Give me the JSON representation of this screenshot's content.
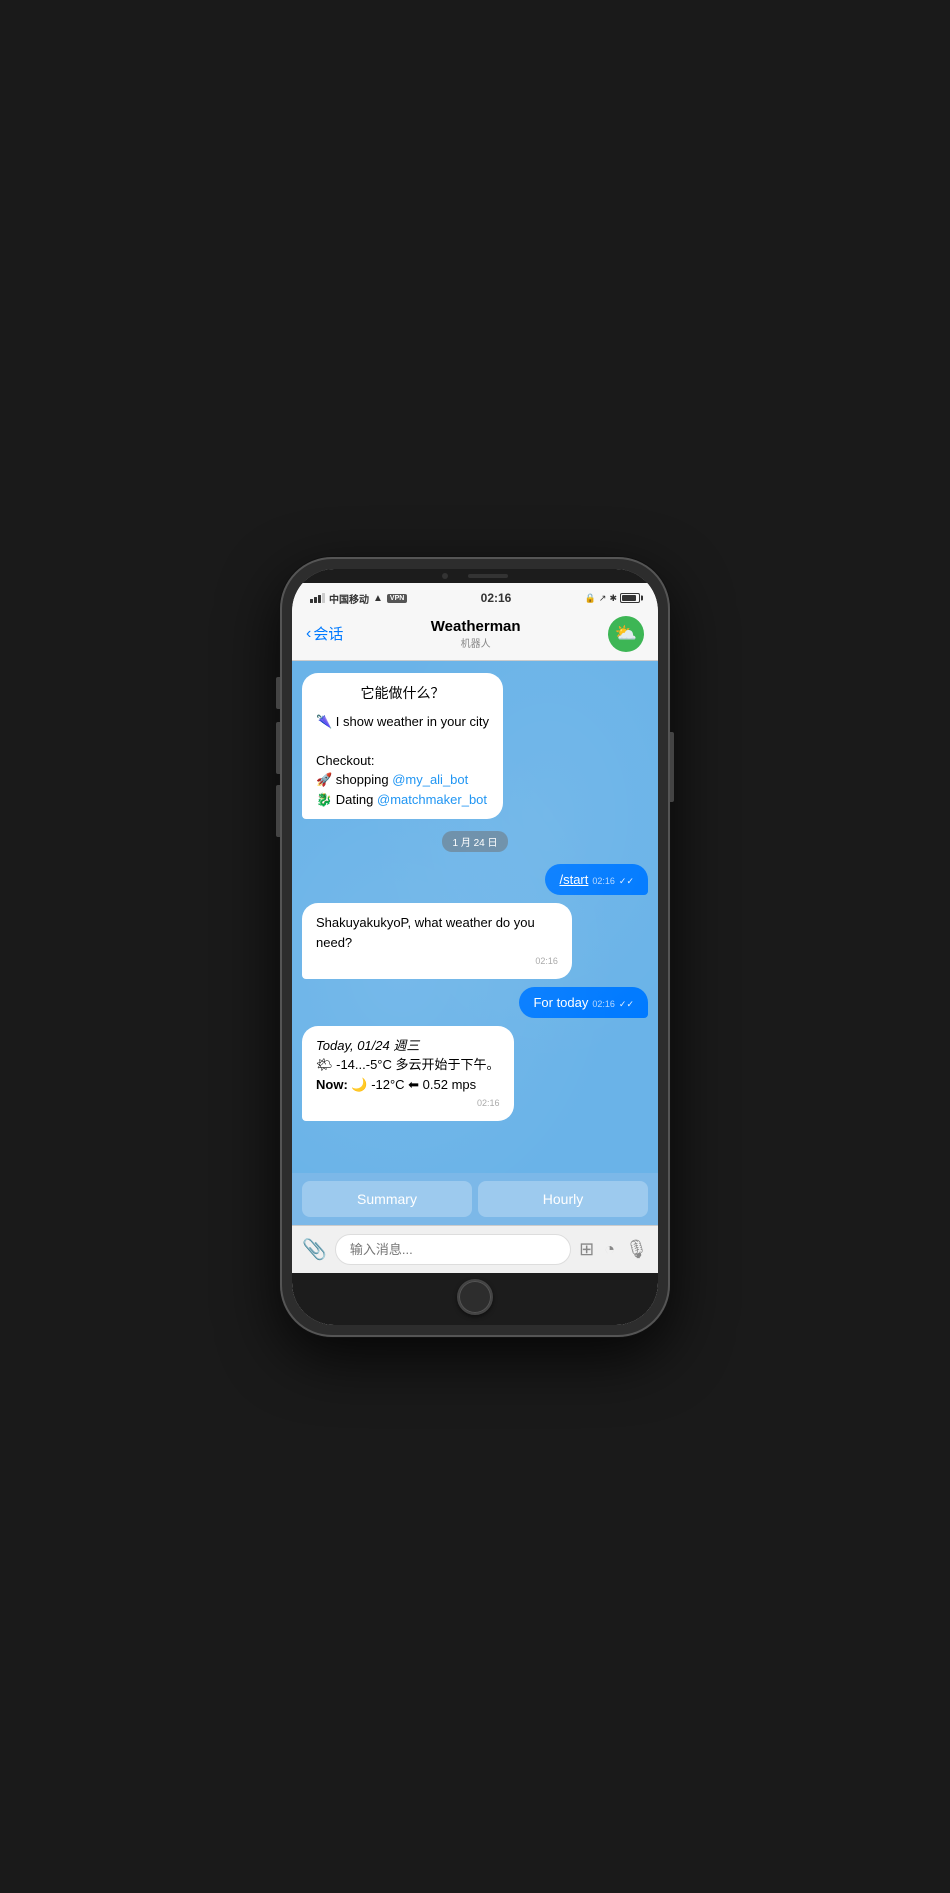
{
  "status": {
    "carrier": "中国移动",
    "time": "02:16",
    "signal_label": "signal",
    "wifi_label": "wifi",
    "vpn_label": "VPN"
  },
  "nav": {
    "back_label": "会话",
    "title": "Weatherman",
    "subtitle": "机器人"
  },
  "messages": [
    {
      "type": "incoming",
      "header": "它能做什么？",
      "lines": [
        "🌂 I show weather in your city",
        "",
        "Checkout:",
        "🚀 shopping @my_ali_bot",
        "🐉 Dating @matchmaker_bot"
      ]
    },
    {
      "type": "date",
      "text": "1 月 24 日"
    },
    {
      "type": "outgoing",
      "text": "/start",
      "time": "02:16",
      "checks": "✓✓"
    },
    {
      "type": "incoming",
      "text": "ShakuyakukyoP, what weather do you need?",
      "time": "02:16"
    },
    {
      "type": "outgoing",
      "text": "For today",
      "time": "02:16",
      "checks": "✓✓"
    },
    {
      "type": "incoming_weather",
      "line1": "Today, 01/24 週三",
      "line2": "🌤 -14...-5°C 多云开始于下午。",
      "line3": "Now: 🌙 -12°C ⬅ 0.52 mps",
      "time": "02:16"
    }
  ],
  "buttons": {
    "summary": "Summary",
    "hourly": "Hourly"
  },
  "input": {
    "placeholder": "输入消息..."
  },
  "avatar_emoji": "⛅"
}
